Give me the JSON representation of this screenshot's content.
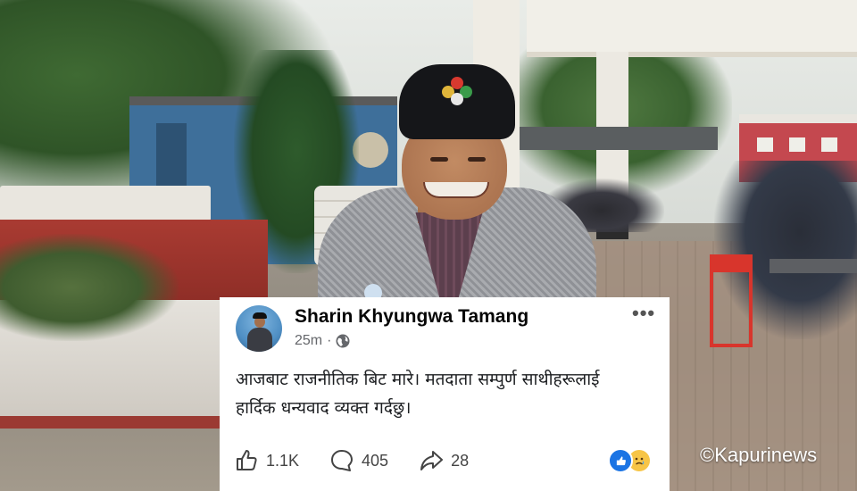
{
  "post": {
    "author": "Sharin Khyungwa Tamang",
    "time": "25m",
    "separator": "·",
    "text_line1": "आजबाट राजनीतिक बिट मारे। मतदाता सम्पुर्ण साथीहरूलाई",
    "text_line2": "हार्दिक धन्यवाद व्यक्त गर्दछु।",
    "more": "•••"
  },
  "actions": {
    "likes": "1.1K",
    "comments": "405",
    "shares": "28"
  },
  "icons": {
    "privacy": "globe-icon",
    "like": "thumbs-up-icon",
    "comment": "comment-bubble-icon",
    "share": "share-arrow-icon",
    "reactions": [
      "like-reaction-icon",
      "sad-reaction-icon"
    ]
  },
  "colors": {
    "facebook_blue": "#1b74e4",
    "reaction_yellow": "#f7c547",
    "card_background": "#ffffff"
  },
  "watermark": "©Kapurinews"
}
